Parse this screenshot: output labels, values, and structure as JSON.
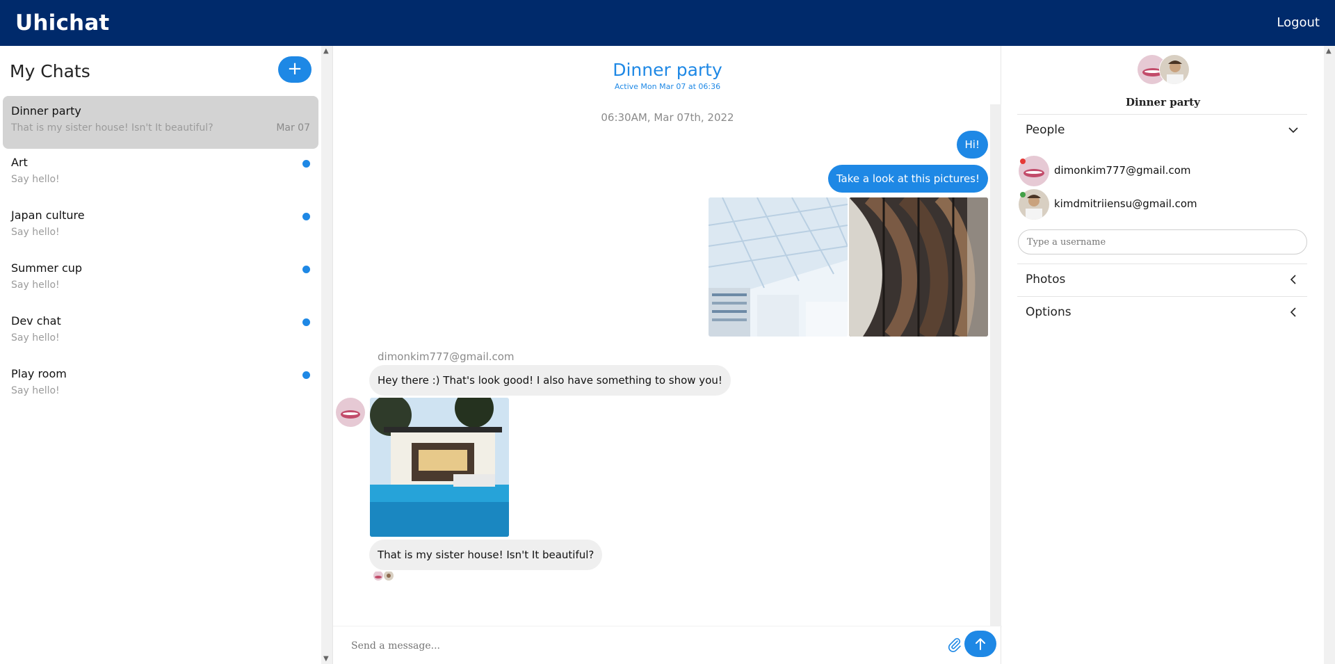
{
  "app": {
    "brand": "Uhichat",
    "logout_label": "Logout"
  },
  "sidebar": {
    "title": "My Chats",
    "new_chat_label": "+",
    "chats": [
      {
        "name": "Dinner party",
        "preview": "That is my sister house! Isn't It beautiful?",
        "date": "Mar 07",
        "active": true,
        "unread": false
      },
      {
        "name": "Art",
        "preview": "Say hello!",
        "date": "",
        "active": false,
        "unread": true
      },
      {
        "name": "Japan culture",
        "preview": "Say hello!",
        "date": "",
        "active": false,
        "unread": true
      },
      {
        "name": "Summer cup",
        "preview": "Say hello!",
        "date": "",
        "active": false,
        "unread": true
      },
      {
        "name": "Dev chat",
        "preview": "Say hello!",
        "date": "",
        "active": false,
        "unread": true
      },
      {
        "name": "Play room",
        "preview": "Say hello!",
        "date": "",
        "active": false,
        "unread": true
      }
    ]
  },
  "conversation": {
    "title": "Dinner party",
    "status": "Active Mon Mar 07 at 06:36",
    "date_divider": "06:30AM, Mar 07th, 2022",
    "messages": {
      "out_1": "Hi!",
      "out_2": "Take a look at this pictures!",
      "sender": "dimonkim777@gmail.com",
      "in_1": "Hey there :) That's look good! I also have something to show you!",
      "in_2": "That is my sister house! Isn't It beautiful?"
    },
    "composer_placeholder": "Send a message..."
  },
  "details": {
    "group_name": "Dinner party",
    "people_label": "People",
    "people": [
      {
        "email": "dimonkim777@gmail.com",
        "status_color": "#e53935"
      },
      {
        "email": "kimdmitriiensu@gmail.com",
        "status_color": "#43a047"
      }
    ],
    "username_placeholder": "Type a username",
    "photos_label": "Photos",
    "options_label": "Options"
  },
  "colors": {
    "accent": "#1e88e5",
    "header_bg": "#002a6b"
  },
  "icons": [
    "plus-icon",
    "attach-icon",
    "arrow-up-icon",
    "chevron-down-icon",
    "chevron-left-icon"
  ]
}
